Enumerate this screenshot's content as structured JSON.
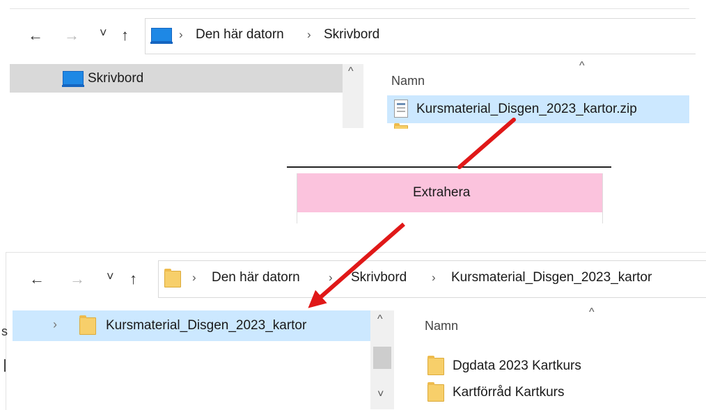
{
  "top_window": {
    "nav": {
      "back": "←",
      "forward": "→",
      "recent": "˅",
      "up": "↑"
    },
    "breadcrumb": [
      "Den här datorn",
      "Skrivbord"
    ],
    "nav_pane_item": "Skrivbord",
    "column_header": "Namn",
    "file": "Kursmaterial_Disgen_2023_kartor.zip"
  },
  "context_menu": {
    "item": "Extrahera"
  },
  "bottom_window": {
    "nav": {
      "back": "←",
      "forward": "→",
      "recent": "˅",
      "up": "↑"
    },
    "breadcrumb": [
      "Den här datorn",
      "Skrivbord",
      "Kursmaterial_Disgen_2023_kartor"
    ],
    "nav_pane_item": "Kursmaterial_Disgen_2023_kartor",
    "column_header": "Namn",
    "folders": [
      "Dgdata 2023 Kartkurs",
      "Kartförråd Kartkurs"
    ]
  },
  "colors": {
    "selection_blue": "#cce8ff",
    "nav_selected_gray": "#d9d9d9",
    "menu_pink": "#fbc3dd",
    "arrow_red": "#e01818"
  }
}
